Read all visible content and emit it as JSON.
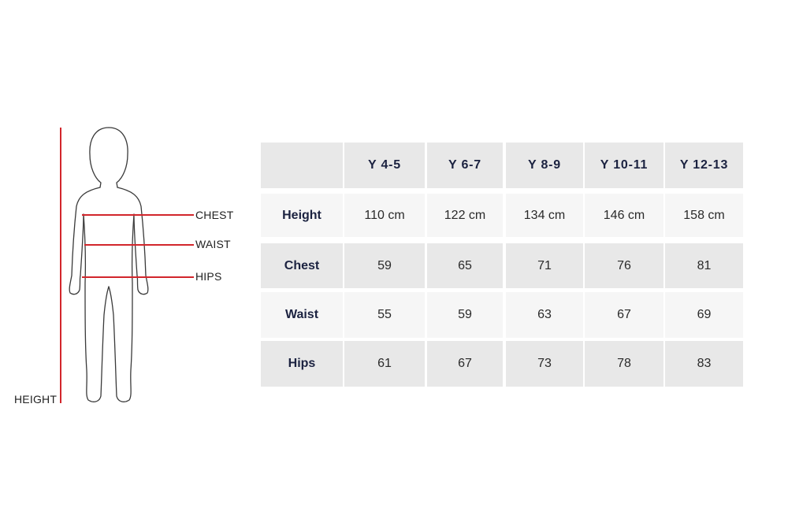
{
  "figure": {
    "labels": {
      "chest": "CHEST",
      "waist": "WAIST",
      "hips": "HIPS",
      "height": "HEIGHT"
    },
    "line_color": "#d2262c",
    "outline_color": "#3a3a3a"
  },
  "table": {
    "header": [
      "",
      "Y 4-5",
      "Y 6-7",
      "Y 8-9",
      "Y 10-11",
      "Y 12-13"
    ],
    "rows": [
      {
        "label": "Height",
        "values": [
          "110 cm",
          "122 cm",
          "134 cm",
          "146 cm",
          "158 cm"
        ]
      },
      {
        "label": "Chest",
        "values": [
          "59",
          "65",
          "71",
          "76",
          "81"
        ]
      },
      {
        "label": "Waist",
        "values": [
          "55",
          "59",
          "63",
          "67",
          "69"
        ]
      },
      {
        "label": "Hips",
        "values": [
          "61",
          "67",
          "73",
          "78",
          "83"
        ]
      }
    ],
    "colors": {
      "shaded": "#e8e8e8",
      "light": "#f6f6f6",
      "header_text": "#1b2240"
    }
  }
}
